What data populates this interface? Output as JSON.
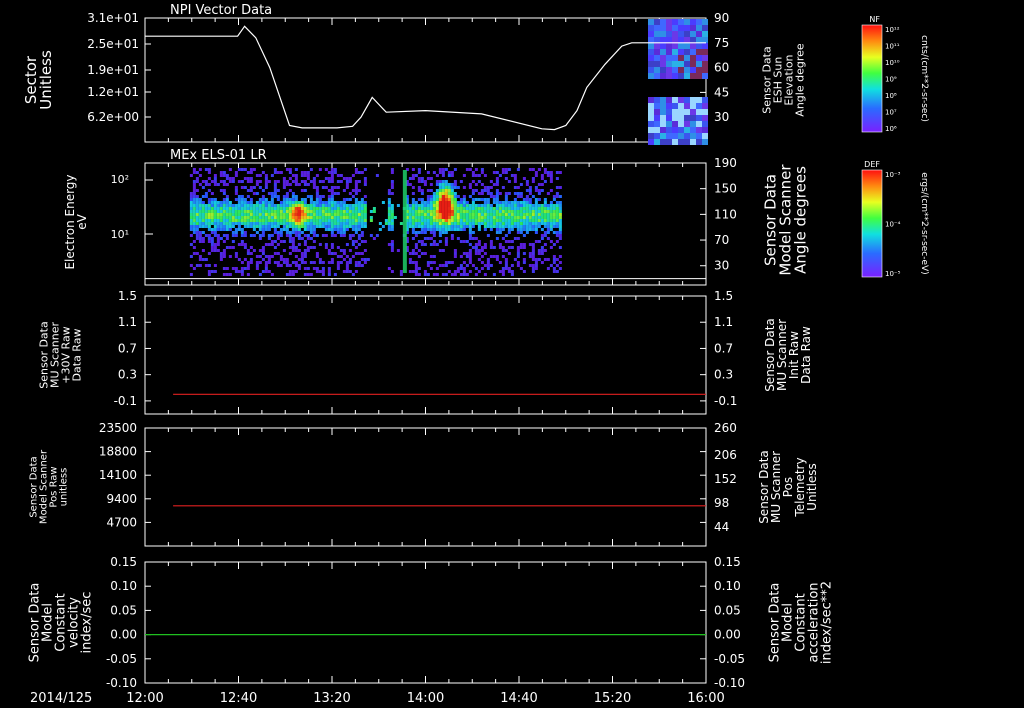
{
  "chart_data": [
    {
      "type": "line",
      "title": "NPI Vector Data",
      "ylabel": "Sector Unitless",
      "yticks": [
        "3.1e+01",
        "2.5e+01",
        "1.9e+01",
        "1.2e+01",
        "6.2e+00"
      ],
      "ylabel_right": "Sensor Data ESH Sun Elevation Angle degree",
      "yticks_right": [
        "90",
        "75",
        "60",
        "45",
        "30"
      ],
      "ylim_right": [
        15,
        90
      ],
      "series": [
        {
          "color": "#ffffff",
          "x": [
            0,
            0.66,
            0.71,
            0.79,
            0.89,
            1.03,
            1.12,
            1.37,
            1.48,
            1.54,
            1.62,
            1.72,
            2.0,
            2.4,
            2.83,
            2.92,
            3.0,
            3.08,
            3.15,
            3.28,
            3.4,
            3.47,
            3.61,
            4.0
          ],
          "y": [
            79,
            79,
            85,
            78,
            60,
            25,
            23.5,
            23.5,
            24.5,
            30,
            42,
            33,
            34,
            32,
            23,
            22.5,
            25,
            34,
            48,
            62,
            73,
            75,
            75,
            75
          ]
        }
      ],
      "spectrogram_note": "color patches at 15:30-16:00",
      "colorbar": {
        "label": "NF",
        "units": "cnts/(cm**2-sr-sec)",
        "ticks": [
          "10¹²",
          "10¹¹",
          "10¹⁰",
          "10⁹",
          "10⁸",
          "10⁷",
          "10⁶"
        ]
      }
    },
    {
      "type": "heatmap",
      "title": "MEx ELS-01 LR",
      "ylabel": "Electron Energy eV",
      "yticks": [
        "10²",
        "10¹"
      ],
      "ylabel_right": "Sensor Data Model Scanner Angle degrees",
      "yticks_right": [
        "190",
        "150",
        "110",
        "70",
        "30"
      ],
      "ylim_right": [
        0,
        190
      ],
      "data_window": [
        0.32,
        2.96
      ],
      "hotspots": [
        {
          "t": 1.08,
          "note": "moderate peak"
        },
        {
          "t": 2.13,
          "note": "strong peak"
        }
      ],
      "overlay_line_degrees": 10,
      "colorbar": {
        "label": "DEF",
        "units": "ergs/(cm**2-sr-sec-eV)",
        "ticks": [
          "10⁻³",
          "10⁻⁴",
          "10⁻⁵"
        ]
      }
    },
    {
      "type": "line",
      "ylabel": "Sensor Data MU Scanner +30V Raw Data Raw",
      "yticks": [
        "1.5",
        "1.1",
        "0.7",
        "0.3",
        "-0.1"
      ],
      "ylim": [
        -0.3,
        1.5
      ],
      "ylabel_right": "Sensor Data MU Scanner Init Raw Data Raw",
      "yticks_right": [
        "1.5",
        "1.1",
        "0.7",
        "0.3",
        "-0.1"
      ],
      "right_label_color": "#ff3030",
      "series": [
        {
          "color": "#e02020",
          "x": [
            0.2,
            4.0
          ],
          "y": [
            0,
            0
          ]
        }
      ]
    },
    {
      "type": "line",
      "ylabel": "Sensor Data Model Scanner Pos Raw unitless",
      "yticks": [
        "23500",
        "18800",
        "14100",
        "9400",
        "4700"
      ],
      "ylim": [
        0,
        23500
      ],
      "ylabel_right": "Sensor Data MU Scanner Pos Telemetry Unitless",
      "yticks_right": [
        "260",
        "206",
        "152",
        "98",
        "44"
      ],
      "right_label_color": "#ff3030",
      "series": [
        {
          "color": "#e02020",
          "x": [
            0.2,
            4.0
          ],
          "y": [
            8000,
            8000
          ]
        }
      ]
    },
    {
      "type": "line",
      "ylabel": "Sensor Data Model Constant velocity index/sec",
      "yticks": [
        "0.15",
        "0.10",
        "0.05",
        "0.00",
        "-0.05",
        "-0.10"
      ],
      "ylim": [
        -0.1,
        0.15
      ],
      "ylabel_right": "Sensor Data Model Constant acceleration index/sec**2",
      "yticks_right": [
        "0.15",
        "0.10",
        "0.05",
        "0.00",
        "-0.05",
        "-0.10"
      ],
      "right_label_color": "#33dd33",
      "series": [
        {
          "color": "#20c020",
          "x": [
            0,
            4.0
          ],
          "y": [
            0,
            0
          ]
        }
      ]
    }
  ],
  "xaxis": {
    "date": "2014/125",
    "ticks": [
      "12:00",
      "12:40",
      "13:20",
      "14:00",
      "14:40",
      "15:20",
      "16:00"
    ]
  }
}
